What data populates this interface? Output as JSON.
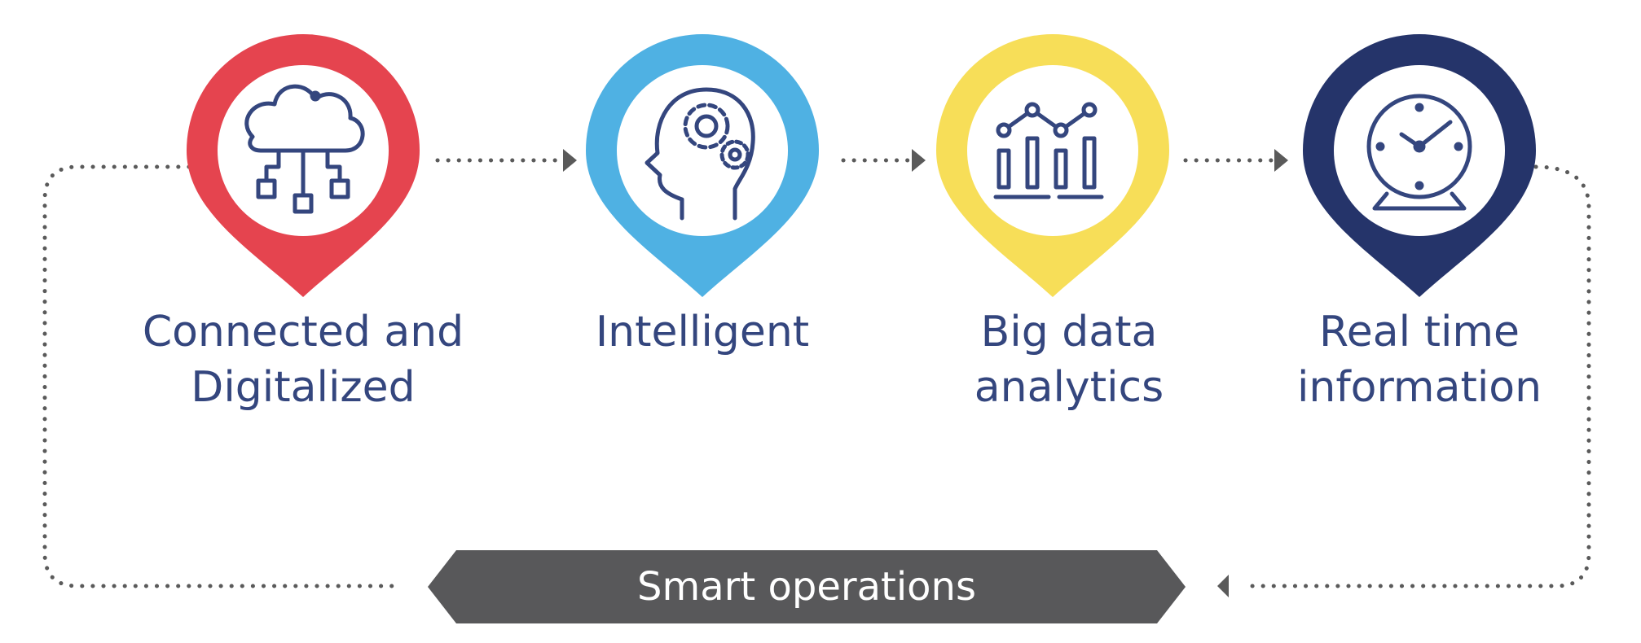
{
  "steps": [
    {
      "icon": "cloud-network-icon",
      "color": "#e5444f",
      "line1": "Connected and",
      "line2": "Digitalized"
    },
    {
      "icon": "brain-gears-icon",
      "color": "#4fb1e3",
      "line1": "Intelligent",
      "line2": ""
    },
    {
      "icon": "analytics-chart-icon",
      "color": "#f7de58",
      "line1": "Big data",
      "line2": "analytics"
    },
    {
      "icon": "clock-icon",
      "color": "#25346a",
      "line1": "Real time",
      "line2": "information"
    }
  ],
  "outcome": {
    "label": "Smart operations",
    "color": "#58585a"
  },
  "colors": {
    "text": "#34467e",
    "icon_stroke": "#34467e",
    "connector": "#5a5a5a"
  }
}
